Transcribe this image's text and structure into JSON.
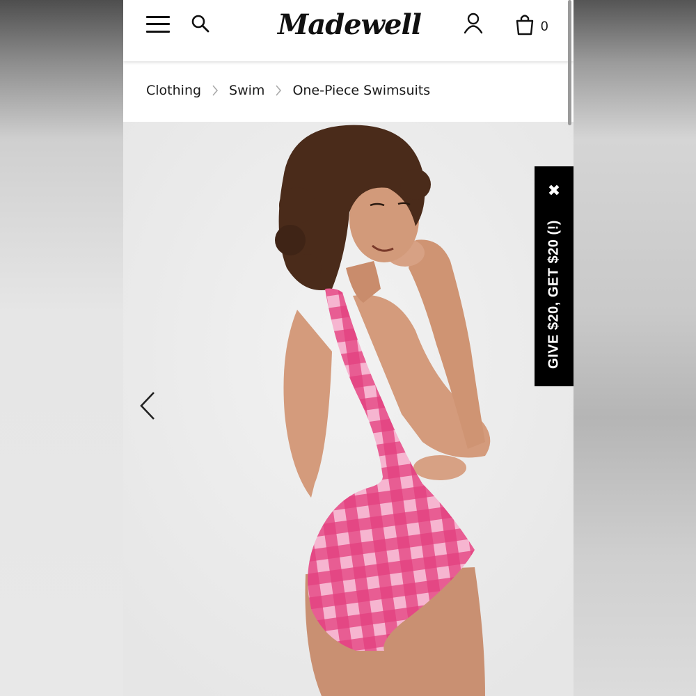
{
  "header": {
    "logo_text": "Madewell",
    "menu_icon": "hamburger-menu-icon",
    "search_icon": "search-icon",
    "account_icon": "user-icon",
    "bag_icon": "shopping-bag-icon",
    "bag_count": "0"
  },
  "breadcrumb": {
    "items": [
      "Clothing",
      "Swim",
      "One-Piece Swimsuits"
    ],
    "separator_icon": "chevron-right-icon"
  },
  "product_image": {
    "prev_icon": "chevron-left-icon"
  },
  "promo_tab": {
    "text": "GIVE $20, GET $20 (!)",
    "close_symbol": "✖"
  },
  "colors": {
    "header_bg": "#ffffff",
    "promo_bg": "#000000",
    "swimsuit_pink": "#e2407f",
    "swimsuit_light": "#f4a3c5"
  }
}
